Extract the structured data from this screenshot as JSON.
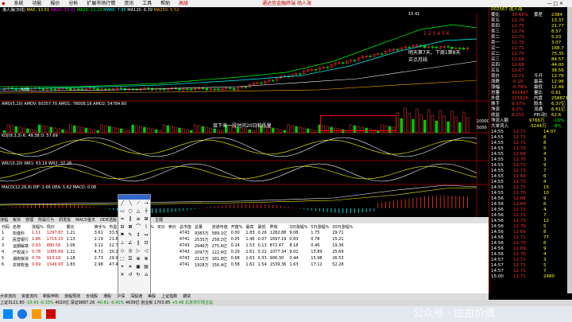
{
  "menubar": {
    "items": [
      "系统",
      "功能",
      "报价",
      "分析",
      "扩展市场行情",
      "资讯",
      "工具",
      "帮助"
    ],
    "extra": "高级",
    "center_title": "通达信金融终端 渤人海",
    "window_controls": "— □ ×"
  },
  "chart_header": {
    "stock": "渤人海(日线)",
    "ma_legend": [
      "MA5: 13.51",
      "MA10: 13.41",
      "MA20: 11.23",
      "MA60: 7.95",
      "MA120: 6.39",
      "MA250: 5.52"
    ],
    "high_label": "15.41",
    "low_label": "4.85"
  },
  "annotations": {
    "bullet_numbers": [
      "1",
      "2",
      "3",
      "4",
      "5",
      "6"
    ],
    "note1": "明天第7天，下周1第8天",
    "note2": "买点月线",
    "note3": "接下来一段时间20日和低量"
  },
  "volume_panel": {
    "label": "AMO(5,20) AMOV: 60357.70 AMO1: 78008.18 AMO2: 54784.60",
    "axis": [
      "10000",
      "5000"
    ]
  },
  "kdj_panel": {
    "label": "KDJ(9,3,3) K: 49.38 D: 57.69"
  },
  "wr_panel": {
    "label": "WR(10,20) WR1: 63.16 WR2: 37.26"
  },
  "macd_panel": {
    "label": "MACD(12,26,9) DIF: 1.66 DEA: 1.62 MACD: 0.08"
  },
  "right_panel": {
    "code": "002567 渤人海",
    "rows": [
      [
        "委比",
        "39.66%",
        "委差",
        "2384"
      ],
      [
        "卖五",
        "12.76",
        "",
        "13.37"
      ],
      [
        "卖四",
        "12.75",
        "",
        "21.77"
      ],
      [
        "卖三",
        "12.74",
        "",
        "8.57"
      ],
      [
        "卖二",
        "12.73",
        "",
        "5.23"
      ],
      [
        "卖一",
        "12.72",
        "",
        "3.07"
      ],
      [
        "买一",
        "12.71",
        "",
        "168.7"
      ],
      [
        "买二",
        "12.70",
        "",
        "75.35"
      ],
      [
        "买三",
        "12.69",
        "",
        "84.57"
      ],
      [
        "买四",
        "12.68",
        "",
        "44.00"
      ],
      [
        "买五",
        "12.67",
        "",
        "38.56"
      ],
      [
        "现价",
        "12.71",
        "今开",
        "12.76"
      ],
      [
        "涨跌",
        "-0.10",
        "最高",
        "12.96"
      ],
      [
        "涨幅",
        "-0.78%",
        "最低",
        "12.49"
      ],
      [
        "总量",
        "402497",
        "量比",
        "0.61"
      ],
      [
        "外盘",
        "215625",
        "内盘",
        "258871"
      ],
      [
        "换手",
        "6.37%",
        "股本",
        "6.37亿"
      ],
      [
        "净资",
        "4.2%",
        "流通",
        "6.61亿"
      ],
      [
        "收益",
        "8.152",
        "PE(动)",
        "62.6"
      ]
    ],
    "flow": [
      [
        "净流入额",
        "9766万",
        "-16%"
      ],
      [
        "大单流入",
        "-3244万",
        "-8%"
      ]
    ],
    "ticks": [
      [
        "14:55",
        "12.71",
        "14.07"
      ],
      [
        "14:55",
        "12.72",
        "8"
      ],
      [
        "14:55",
        "12.71",
        "8"
      ],
      [
        "14:55",
        "12.70",
        "5"
      ],
      [
        "14:55",
        "12.69",
        "4"
      ],
      [
        "14:55",
        "12.70",
        "3"
      ],
      [
        "14:55",
        "12.71",
        "9"
      ],
      [
        "14:55",
        "12.73",
        "7"
      ],
      [
        "14:55",
        "12.69",
        "6"
      ],
      [
        "14:55",
        "12.72",
        "4"
      ],
      [
        "14:55",
        "12.71",
        "15"
      ],
      [
        "14:55",
        "12.70",
        "10"
      ],
      [
        "14:56",
        "12.68",
        "9"
      ],
      [
        "14:56",
        "12.69",
        "6"
      ],
      [
        "14:56",
        "12.71",
        "4"
      ],
      [
        "14:56",
        "12.72",
        "7"
      ],
      [
        "14:56",
        "12.73",
        "12"
      ],
      [
        "14:56",
        "12.70",
        "5"
      ],
      [
        "14:56",
        "12.69",
        "8"
      ],
      [
        "14:56",
        "12.71",
        "77"
      ],
      [
        "14:56",
        "12.70",
        "6"
      ],
      [
        "14:56",
        "12.69",
        "9"
      ],
      [
        "14:56",
        "12.70",
        "4"
      ],
      [
        "14:57",
        "12.71",
        "3"
      ],
      [
        "14:57",
        "12.73",
        "5"
      ],
      [
        "14:57",
        "12.71",
        "7"
      ],
      [
        "15:00",
        "12.71",
        "2480"
      ]
    ]
  },
  "table": {
    "tabs": [
      "涨幅",
      "板块",
      "管理",
      "所属行为",
      "研发投",
      "MACD金叉",
      "DDE选股",
      "BUP选股",
      "资金",
      "主题"
    ],
    "headers": [
      "代码",
      "名称",
      "涨幅%",
      "现价",
      "量比",
      "",
      "",
      "",
      "",
      "",
      "换手%",
      "市盈",
      "涨跌",
      "均涨幅%",
      "买价",
      "卖价",
      "总市值",
      "总量",
      "流通市值",
      "开盘%",
      "最高",
      "最低",
      "昨收",
      "3日涨幅%",
      "5日涨幅%",
      "20日涨幅%"
    ],
    "rows": [
      [
        "1",
        "松盛科",
        "1.11",
        "1297.87",
        "1.21",
        "",
        "",
        "",
        "",
        "",
        "3.61",
        "33.51",
        "14.19",
        "0.69",
        "",
        "",
        "4743",
        "9383万",
        "589.1亿",
        "0.00",
        "1.83",
        "0.26",
        "1282.88",
        "9.08",
        "1.75",
        "29.71"
      ],
      [
        "2",
        "民营银行",
        "1.86",
        "1715.15",
        "1.13",
        "",
        "",
        "",
        "",
        "",
        "2.19",
        "21.66",
        "18.60",
        "1.00",
        "",
        "",
        "4741",
        "2535万",
        "258.2亿",
        "0.05",
        "1.46",
        "0.07",
        "1697.19",
        "0.83",
        "0.78",
        "15.21"
      ],
      [
        "3",
        "运期解禁",
        "0.93",
        "880.56",
        "1.06",
        "",
        "",
        "",
        "",
        "",
        "3.12",
        "22.74",
        "6.08",
        "0.45",
        "",
        "",
        "4743",
        "2946万",
        "275.6亿",
        "0.24",
        "1.53",
        "0.13",
        "872.47",
        "8.18",
        "0.46",
        "19.36"
      ],
      [
        "4",
        "产权减少",
        "0.78",
        "1085.69",
        "1.21",
        "",
        "",
        "",
        "",
        "",
        "4.71",
        "30.21",
        "8.35",
        "0.59",
        "",
        "",
        "4743",
        "2097万",
        "122.4亿",
        "0.29",
        "1.61",
        "0.21",
        "1077.34",
        "9.02",
        "15.89",
        "25.69"
      ],
      [
        "5",
        "湖南板块",
        "0.76",
        "913.18",
        "1.18",
        "",
        "",
        "",
        "",
        "",
        "2.73",
        "29.99",
        "6.80",
        "1.02",
        "",
        "",
        "4743",
        "2115万",
        "181.8亿",
        "0.68",
        "1.63",
        "0.33",
        "906.30",
        "0.44",
        "15.98",
        "26.53"
      ],
      [
        "6",
        "农林牧渔",
        "0.69",
        "1549.93",
        "1.83",
        "",
        "",
        "",
        "",
        "",
        "2.98",
        "47.46",
        "10.57",
        "0.92",
        "",
        "",
        "4741",
        "1928万",
        "156.4亿",
        "0.58",
        "1.62",
        "1.54",
        "1539.36",
        "1.63",
        "17.12",
        "52.28"
      ]
    ]
  },
  "bottom_tabs": [
    "大单流向",
    "资金流向",
    "新股申购",
    "涨幅预测",
    "长线股",
    "港股",
    "沪深",
    "深股通",
    "美股",
    "上证指数",
    "期货"
  ],
  "statusbar": {
    "items": [
      "上证3121.80",
      "-10.43",
      "-0.33%",
      "4020亿",
      "深证9887.26",
      "-40.81",
      "-0.41%",
      "4639亿",
      "创业板 1703.85",
      "+5.46",
      "北京市行情主站"
    ]
  },
  "watermark": "公众号 · 由由价值"
}
